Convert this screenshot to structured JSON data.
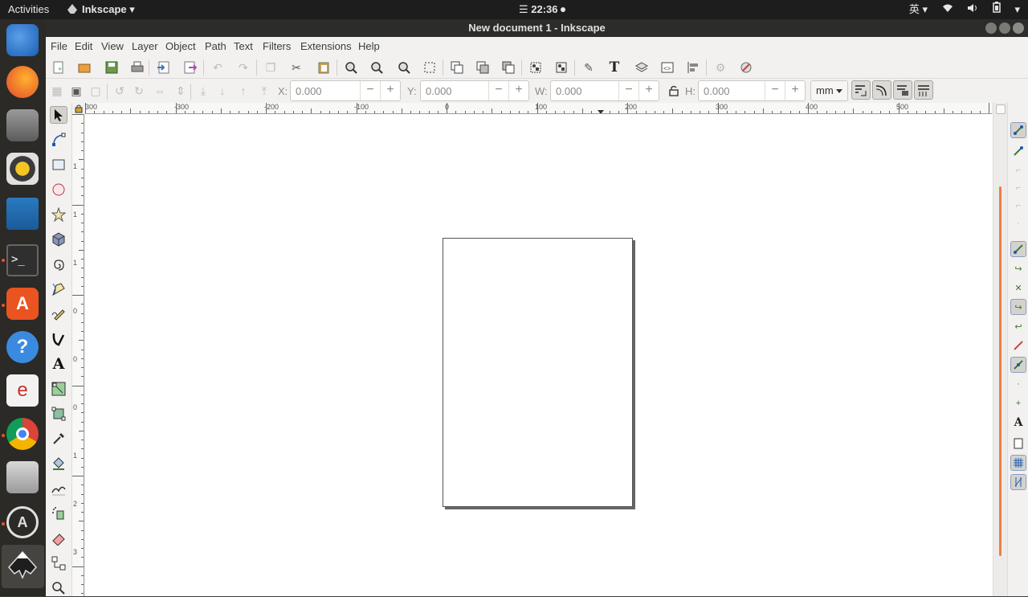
{
  "topbar": {
    "activities": "Activities",
    "app_name": "Inkscape",
    "clock": "☰ 22:36",
    "input_method": "英"
  },
  "window": {
    "title": "New document 1 - Inkscape"
  },
  "menubar": {
    "items": [
      "File",
      "Edit",
      "View",
      "Layer",
      "Object",
      "Path",
      "Text",
      "Filters",
      "Extensions",
      "Help"
    ]
  },
  "controls": {
    "x_label": "X:",
    "x_value": "0.000",
    "y_label": "Y:",
    "y_value": "0.000",
    "w_label": "W:",
    "w_value": "0.000",
    "h_label": "H:",
    "h_value": "0.000",
    "minus": "−",
    "plus": "+",
    "unit": "mm"
  },
  "ruler": {
    "h_labels": [
      "300",
      "-300",
      "-200",
      "-100",
      "0",
      "100",
      "200",
      "300",
      "400",
      "500"
    ],
    "v_labels": [
      "1",
      "1",
      "1",
      "0",
      "0",
      "0",
      "1",
      "2",
      "3",
      "4",
      "5"
    ]
  },
  "colors": {
    "accent": "#e95420",
    "scroll_thumb": "#ef7d43"
  }
}
